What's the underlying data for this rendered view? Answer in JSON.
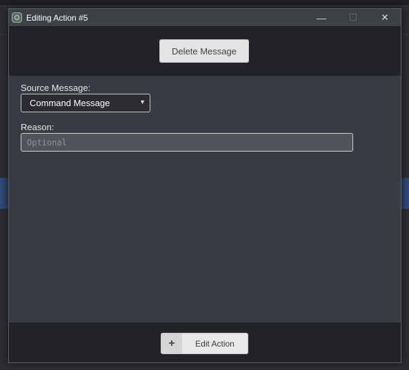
{
  "window": {
    "title": "Editing Action #5",
    "controls": {
      "minimize": "—",
      "maximize": "☐",
      "close": "✕"
    }
  },
  "top": {
    "delete_label": "Delete Message"
  },
  "form": {
    "source_label": "Source Message:",
    "source_value": "Command Message",
    "source_arrow": "▼",
    "reason_label": "Reason:",
    "reason_placeholder": "Optional",
    "reason_value": ""
  },
  "bottom": {
    "plus": "+",
    "edit_label": "Edit Action"
  },
  "icons": {
    "app": "app-icon",
    "dropdown": "chevron-down-icon",
    "add": "plus-icon"
  },
  "colors": {
    "titlebar": "#3c4145",
    "panel_dark": "#222327",
    "content": "#383b41",
    "button_bg": "#e3e3e3"
  }
}
